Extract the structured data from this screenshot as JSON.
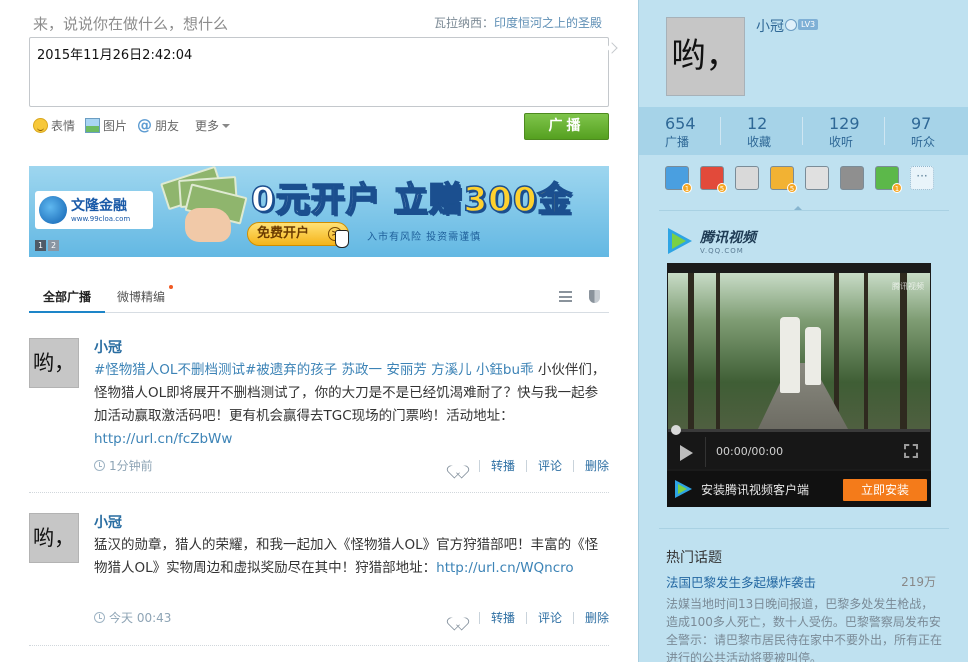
{
  "composer": {
    "prompt": "来，说说你在做什么，想什么",
    "hot_label": "瓦拉纳西：",
    "hot_text": "印度恒河之上的圣殿",
    "content": "2015年11月26日2:42:04",
    "tools": [
      {
        "label": "表情",
        "icon": "emoji-icon"
      },
      {
        "label": "图片",
        "icon": "image-icon"
      },
      {
        "label": "朋友",
        "icon": "at-icon"
      },
      {
        "label": "更多",
        "icon": "chevron-down-icon"
      }
    ],
    "submit_label": "广播"
  },
  "ad": {
    "brand": "文隆金融",
    "brand_url": "www.99cloa.com",
    "headline_a": "0元开户",
    "headline_b": "立赠",
    "headline_c": "300金",
    "cta": "免费开户",
    "cta_arrow": ">",
    "slogan": "入市有风险  投资需谨慎",
    "pages": [
      "1",
      "2"
    ]
  },
  "tabs": [
    {
      "label": "全部广播",
      "active": true
    },
    {
      "label": "微博精编",
      "active": false,
      "dot": true
    }
  ],
  "posts": [
    {
      "avatar_text": "哟，",
      "author": "小冠",
      "highlight": "#怪物猎人OL不删档测试#被遗弃的孩子 苏政一 安丽芳 方溪儿 小鈺bu乖",
      "text": " 小伙伴们，怪物猎人OL即将展开不删档测试了，你的大刀是不是已经饥渴难耐了？快与我一起参加活动赢取激活码吧！更有机会赢得去TGC现场的门票哟！活动地址：",
      "link": "http://url.cn/fcZbWw",
      "time": "1分钟前"
    },
    {
      "avatar_text": "哟，",
      "author": "小冠",
      "highlight": "",
      "text": "猛汉的勋章，猎人的荣耀，和我一起加入《怪物猎人OL》官方狩猎部吧！丰富的《怪物猎人OL》实物周边和虚拟奖励尽在其中！狩猎部地址：",
      "link": "http://url.cn/WQncro",
      "time": "今天 00:43"
    }
  ],
  "post_actions": [
    "转播",
    "评论",
    "删除"
  ],
  "sidebar": {
    "avatar_text": "哟，",
    "name": "小冠",
    "level_badge": "LV3",
    "stats": [
      {
        "num": "654",
        "label": "广播"
      },
      {
        "num": "12",
        "label": "收藏"
      },
      {
        "num": "129",
        "label": "收听"
      },
      {
        "num": "97",
        "label": "听众"
      }
    ],
    "apps": [
      {
        "icon": "phone-app-icon",
        "color": "#4a9fe0",
        "count": "1"
      },
      {
        "icon": "bell-app-icon",
        "color": "#e24a3a",
        "count": "5"
      },
      {
        "icon": "refresh-app-icon",
        "color": "#d9d9d9",
        "count": ""
      },
      {
        "icon": "face-app-icon",
        "color": "#f2b233",
        "count": "5"
      },
      {
        "icon": "clock-app-icon",
        "color": "#e0e0e0",
        "count": ""
      },
      {
        "icon": "music-app-icon",
        "color": "#8f8f8f",
        "count": ""
      },
      {
        "icon": "game-app-icon",
        "color": "#5cb84a",
        "count": "1"
      }
    ],
    "apps_more": "···",
    "video": {
      "brand": "腾讯视频",
      "brand_en": "V.QQ.COM",
      "watermark": "腾讯视频",
      "time": "00:00/00:00",
      "promo": "安装腾讯视频客户端",
      "install": "立即安装"
    },
    "hot": {
      "title": "热门话题",
      "item_title": "法国巴黎发生多起爆炸袭击",
      "item_count": "219万",
      "item_desc": "法媒当地时间13日晚间报道，巴黎多处发生枪战，造成100多人死亡，数十人受伤。巴黎警察局发布安全警示：请巴黎市居民待在家中不要外出，所有正在进行的公共活动将要被叫停。"
    }
  }
}
